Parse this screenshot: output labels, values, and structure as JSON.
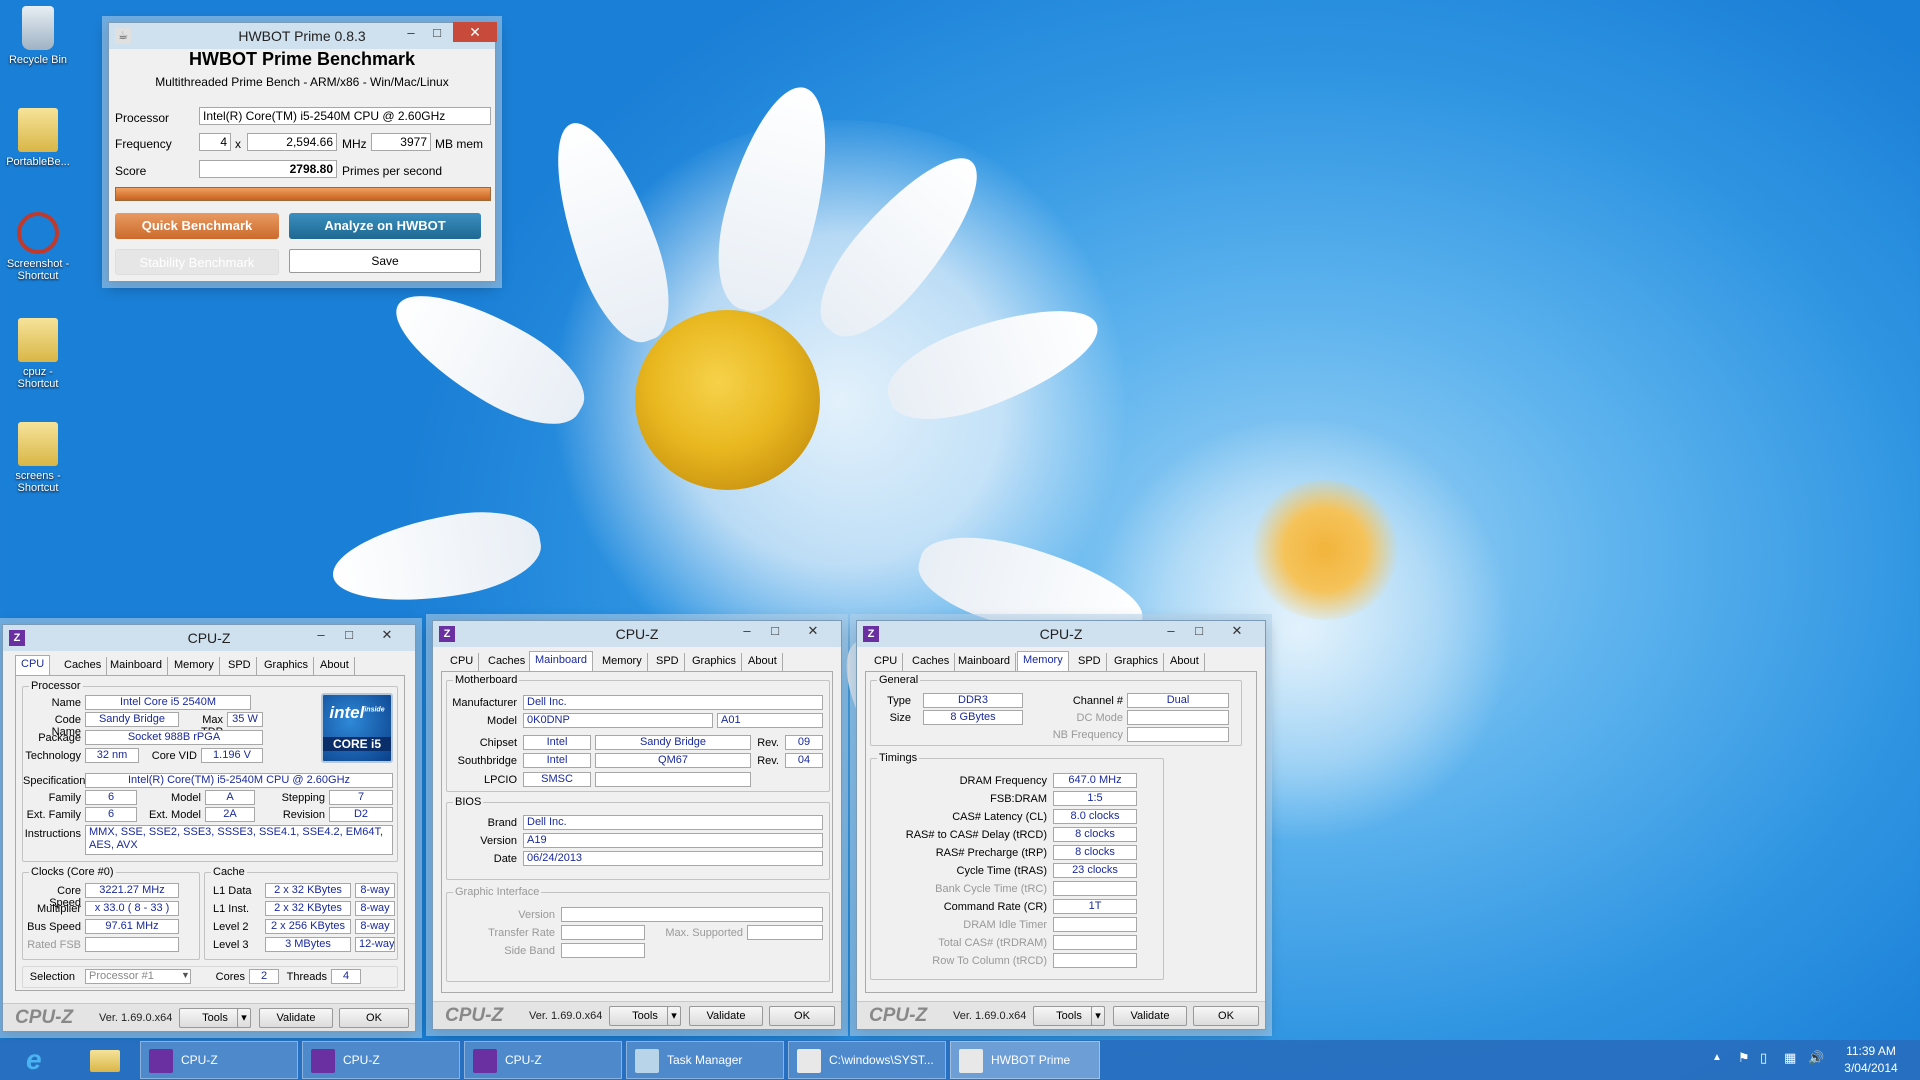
{
  "desktop": {
    "icons": [
      "Recycle Bin",
      "PortableBe...",
      "Screenshot - Shortcut",
      "cpuz - Shortcut",
      "screens - Shortcut"
    ]
  },
  "hwbot": {
    "title": "HWBOT Prime 0.8.3",
    "heading": "HWBOT Prime Benchmark",
    "subheading": "Multithreaded Prime Bench - ARM/x86 - Win/Mac/Linux",
    "processor_label": "Processor",
    "processor": "Intel(R) Core(TM) i5-2540M CPU @ 2.60GHz",
    "frequency_label": "Frequency",
    "threads": "4",
    "x": "x",
    "mhz_value": "2,594.66",
    "mhz": "MHz",
    "mem_value": "3977",
    "mem": "MB mem",
    "score_label": "Score",
    "score": "2798.80",
    "score_unit": "Primes per second",
    "progress": 1.0,
    "quick": "Quick Benchmark",
    "analyze": "Analyze on HWBOT",
    "stability": "Stability Benchmark",
    "save": "Save"
  },
  "cpuz": {
    "title": "CPU-Z",
    "tabs": [
      "CPU",
      "Caches",
      "Mainboard",
      "Memory",
      "SPD",
      "Graphics",
      "About"
    ],
    "version": "Ver. 1.69.0.x64",
    "tools": "Tools",
    "validate": "Validate",
    "ok": "OK",
    "logo": "CPU-Z"
  },
  "cpu": {
    "processor": "Processor",
    "name_l": "Name",
    "name": "Intel Core i5 2540M",
    "codename_l": "Code Name",
    "codename": "Sandy Bridge",
    "maxtdp_l": "Max TDP",
    "maxtdp": "35 W",
    "package_l": "Package",
    "package": "Socket 988B rPGA",
    "tech_l": "Technology",
    "tech": "32 nm",
    "corevid_l": "Core VID",
    "corevid": "1.196 V",
    "spec_l": "Specification",
    "spec": "Intel(R) Core(TM) i5-2540M CPU @ 2.60GHz",
    "family_l": "Family",
    "family": "6",
    "model_l": "Model",
    "model": "A",
    "stepping_l": "Stepping",
    "stepping": "7",
    "extfamily_l": "Ext. Family",
    "extfamily": "6",
    "extmodel_l": "Ext. Model",
    "extmodel": "2A",
    "revision_l": "Revision",
    "revision": "D2",
    "instr_l": "Instructions",
    "instr": "MMX, SSE, SSE2, SSE3, SSSE3, SSE4.1, SSE4.2, EM64T, AES, AVX",
    "clocks": "Clocks (Core #0)",
    "corespeed_l": "Core Speed",
    "corespeed": "3221.27 MHz",
    "mult_l": "Multiplier",
    "mult": "x 33.0 ( 8 - 33 )",
    "bus_l": "Bus Speed",
    "bus": "97.61 MHz",
    "ratedfsb_l": "Rated FSB",
    "cache": "Cache",
    "l1d_l": "L1 Data",
    "l1d": "2 x 32 KBytes",
    "l1d_w": "8-way",
    "l1i_l": "L1 Inst.",
    "l1i": "2 x 32 KBytes",
    "l1i_w": "8-way",
    "l2_l": "Level 2",
    "l2": "2 x 256 KBytes",
    "l2_w": "8-way",
    "l3_l": "Level 3",
    "l3": "3 MBytes",
    "l3_w": "12-way",
    "selection_l": "Selection",
    "selection": "Processor #1",
    "cores_l": "Cores",
    "cores": "2",
    "threads_l": "Threads",
    "threads": "4",
    "intel_brand": "intel",
    "intel_inside": "inside",
    "intel_core": "CORE i5"
  },
  "mainboard": {
    "motherboard": "Motherboard",
    "manufacturer_l": "Manufacturer",
    "manufacturer": "Dell Inc.",
    "model_l": "Model",
    "model": "0K0DNP",
    "model_rev": "A01",
    "chipset_l": "Chipset",
    "chipset_v": "Intel",
    "chipset_n": "Sandy Bridge",
    "rev_l": "Rev.",
    "chipset_rev": "09",
    "south_l": "Southbridge",
    "south_v": "Intel",
    "south_n": "QM67",
    "south_rev": "04",
    "lpcio_l": "LPCIO",
    "lpcio": "SMSC",
    "bios": "BIOS",
    "brand_l": "Brand",
    "brand": "Dell Inc.",
    "version_l": "Version",
    "version": "A19",
    "date_l": "Date",
    "date": "06/24/2013",
    "gi": "Graphic Interface",
    "gi_version_l": "Version",
    "gi_rate_l": "Transfer Rate",
    "gi_max_l": "Max. Supported",
    "gi_side_l": "Side Band"
  },
  "memory": {
    "general": "General",
    "type_l": "Type",
    "type": "DDR3",
    "size_l": "Size",
    "size": "8 GBytes",
    "channel_l": "Channel #",
    "channel": "Dual",
    "dcmode_l": "DC Mode",
    "nbfreq_l": "NB Frequency",
    "timings": "Timings",
    "dram_l": "DRAM Frequency",
    "dram": "647.0 MHz",
    "fsb_l": "FSB:DRAM",
    "fsb": "1:5",
    "cl_l": "CAS# Latency (CL)",
    "cl": "8.0 clocks",
    "rcd_l": "RAS# to CAS# Delay (tRCD)",
    "rcd": "8 clocks",
    "rp_l": "RAS# Precharge (tRP)",
    "rp": "8 clocks",
    "ras_l": "Cycle Time (tRAS)",
    "ras": "23 clocks",
    "rc_l": "Bank Cycle Time (tRC)",
    "cr_l": "Command Rate (CR)",
    "cr": "1T",
    "idle_l": "DRAM Idle Timer",
    "rdram_l": "Total CAS# (tRDRAM)",
    "rtc_l": "Row To Column (tRCD)"
  },
  "taskbar": {
    "items": [
      "CPU-Z",
      "CPU-Z",
      "CPU-Z",
      "Task Manager",
      "C:\\windows\\SYST...",
      "HWBOT Prime 0.8.3"
    ],
    "time": "11:39 AM",
    "date": "3/04/2014"
  },
  "colors": {
    "accent_orange": "#d9783a",
    "accent_blue": "#2576a8",
    "field_text": "#1a2a9a"
  }
}
